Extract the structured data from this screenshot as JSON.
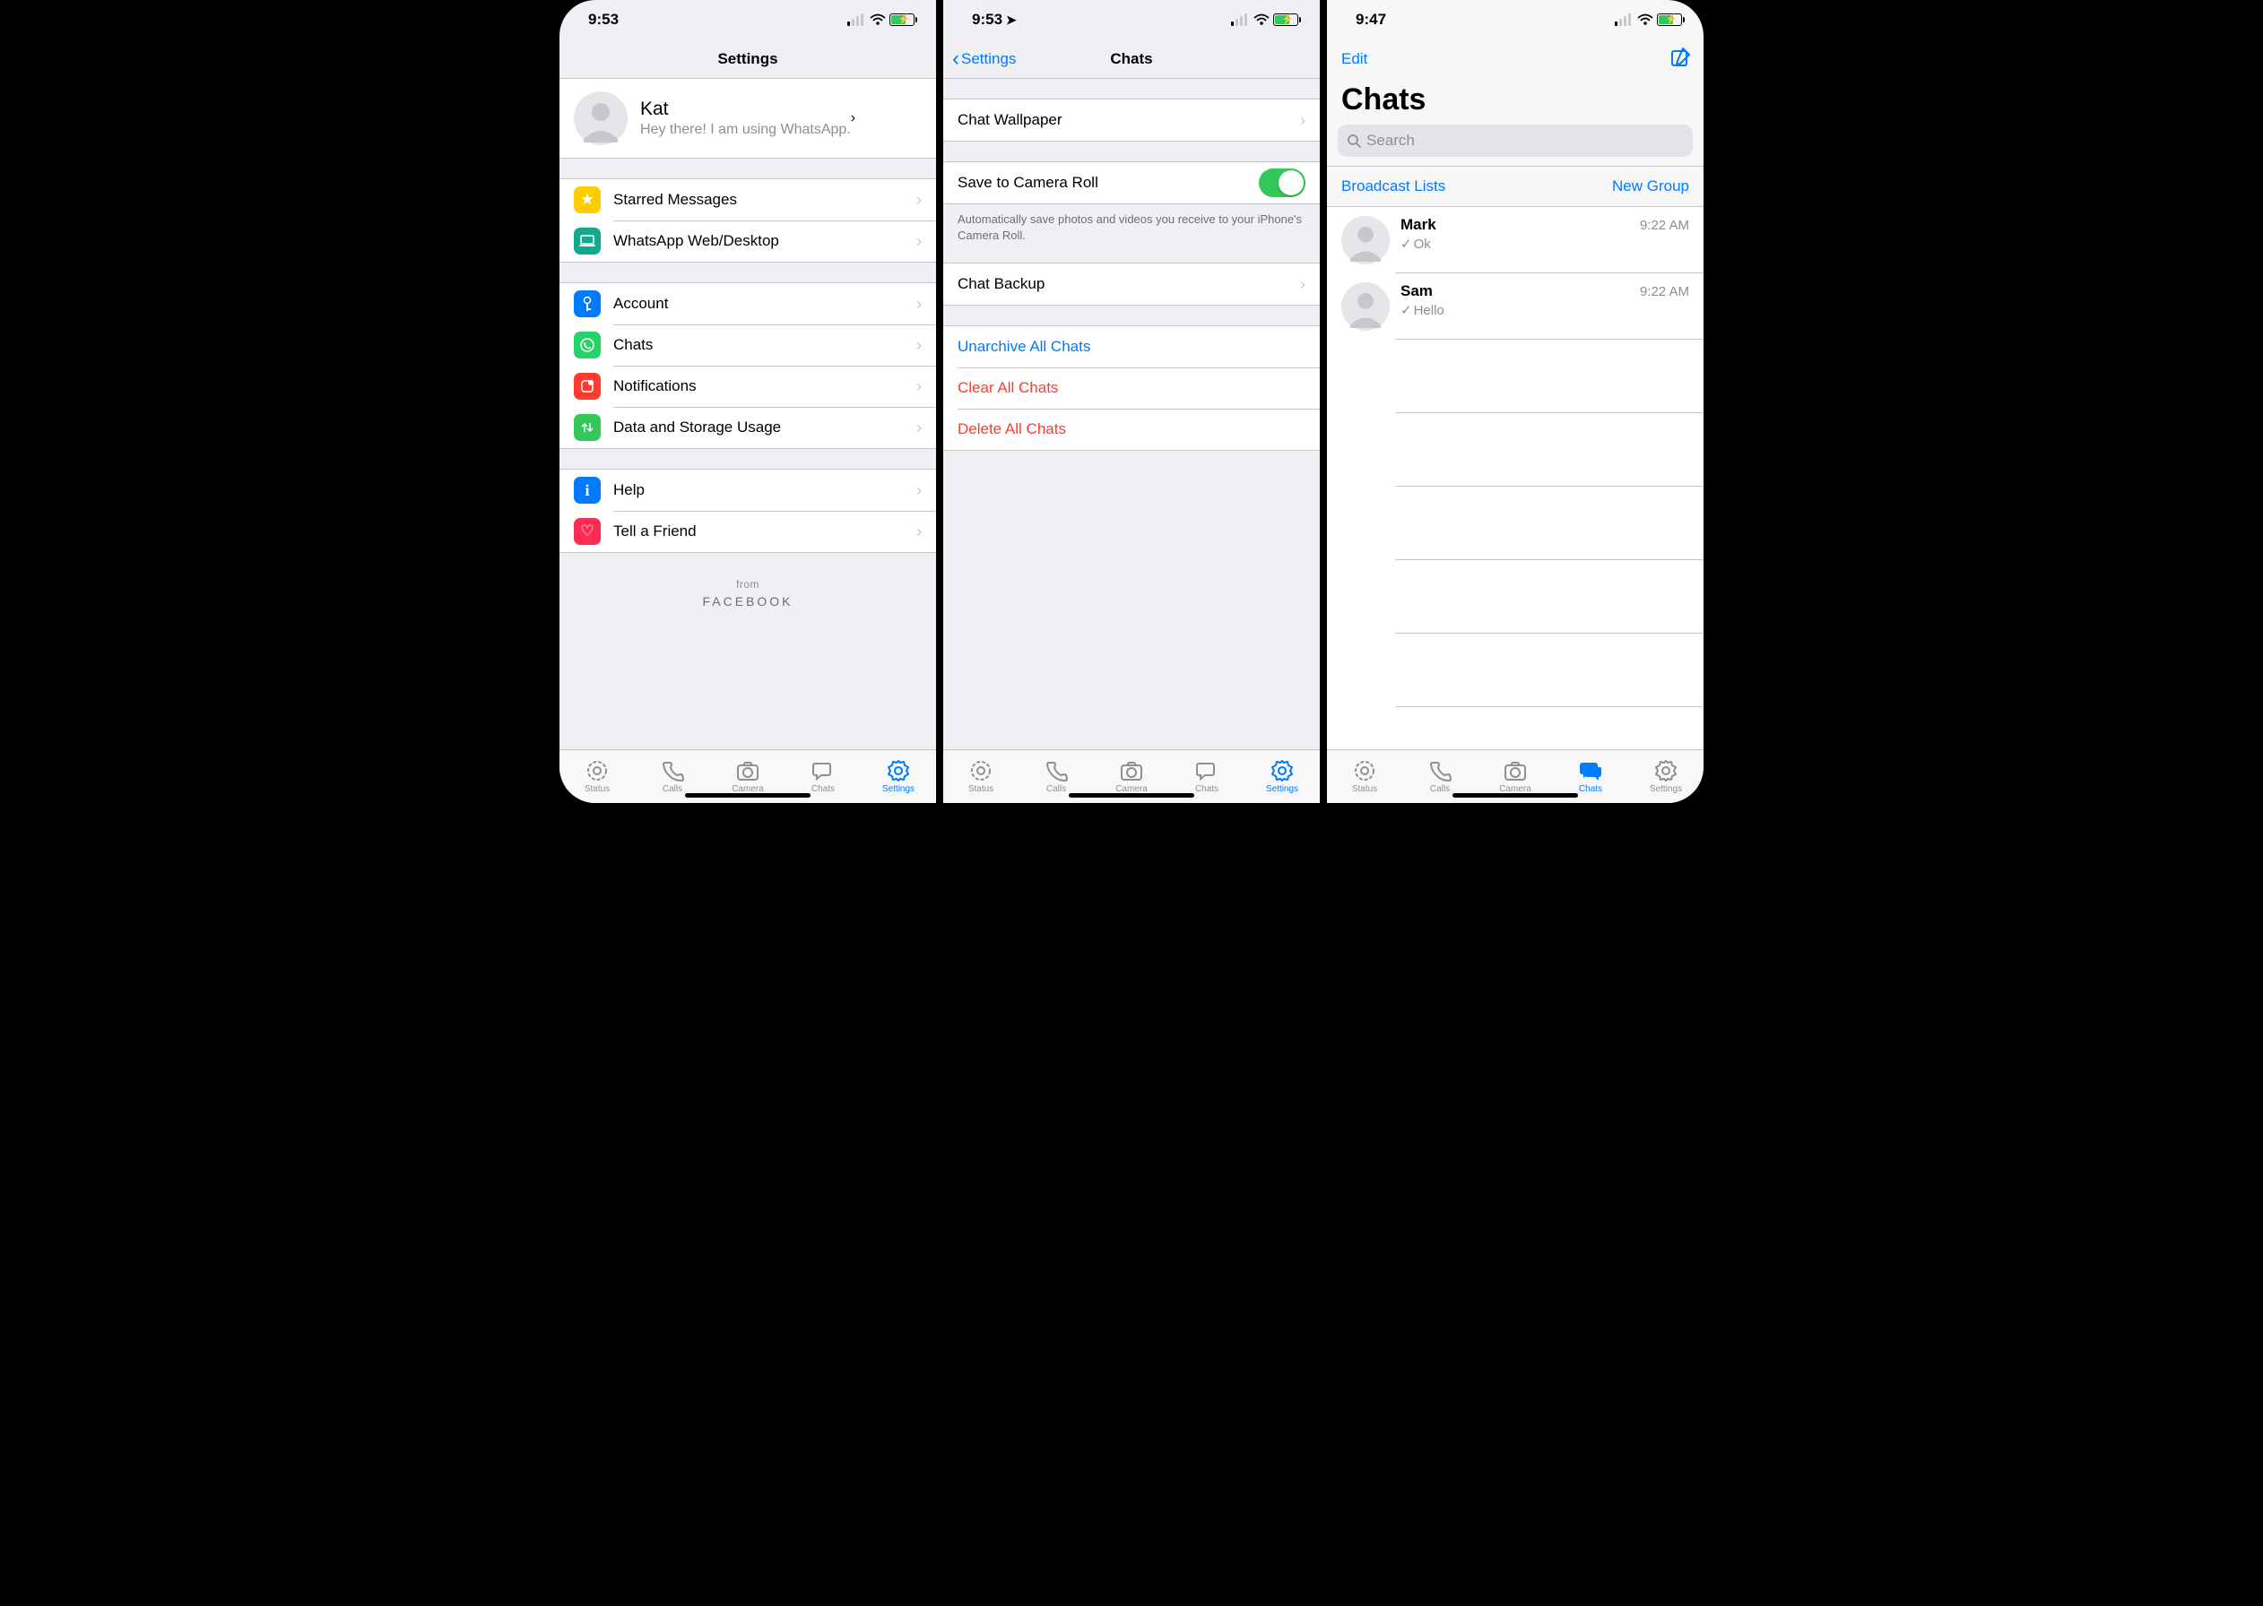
{
  "screens": {
    "settings": {
      "time": "9:53",
      "title": "Settings",
      "profile": {
        "name": "Kat",
        "status": "Hey there! I am using WhatsApp."
      },
      "starred": "Starred Messages",
      "webdesktop": "WhatsApp Web/Desktop",
      "account": "Account",
      "chats": "Chats",
      "notifications": "Notifications",
      "data": "Data and Storage Usage",
      "help": "Help",
      "tell": "Tell a Friend",
      "from": "from",
      "facebook": "FACEBOOK"
    },
    "chatsettings": {
      "time": "9:53",
      "back": "Settings",
      "title": "Chats",
      "wallpaper": "Chat Wallpaper",
      "savecr": "Save to Camera Roll",
      "savecr_note": "Automatically save photos and videos you receive to your iPhone's Camera Roll.",
      "backup": "Chat Backup",
      "unarchive": "Unarchive All Chats",
      "clear": "Clear All Chats",
      "delete": "Delete All Chats"
    },
    "chatlist": {
      "time": "9:47",
      "edit": "Edit",
      "title": "Chats",
      "search_placeholder": "Search",
      "broadcast": "Broadcast Lists",
      "newgroup": "New Group",
      "items": [
        {
          "name": "Mark",
          "preview": "Ok",
          "time": "9:22 AM"
        },
        {
          "name": "Sam",
          "preview": "Hello",
          "time": "9:22 AM"
        }
      ]
    }
  },
  "tabs": {
    "status": "Status",
    "calls": "Calls",
    "camera": "Camera",
    "chats": "Chats",
    "settings": "Settings"
  }
}
